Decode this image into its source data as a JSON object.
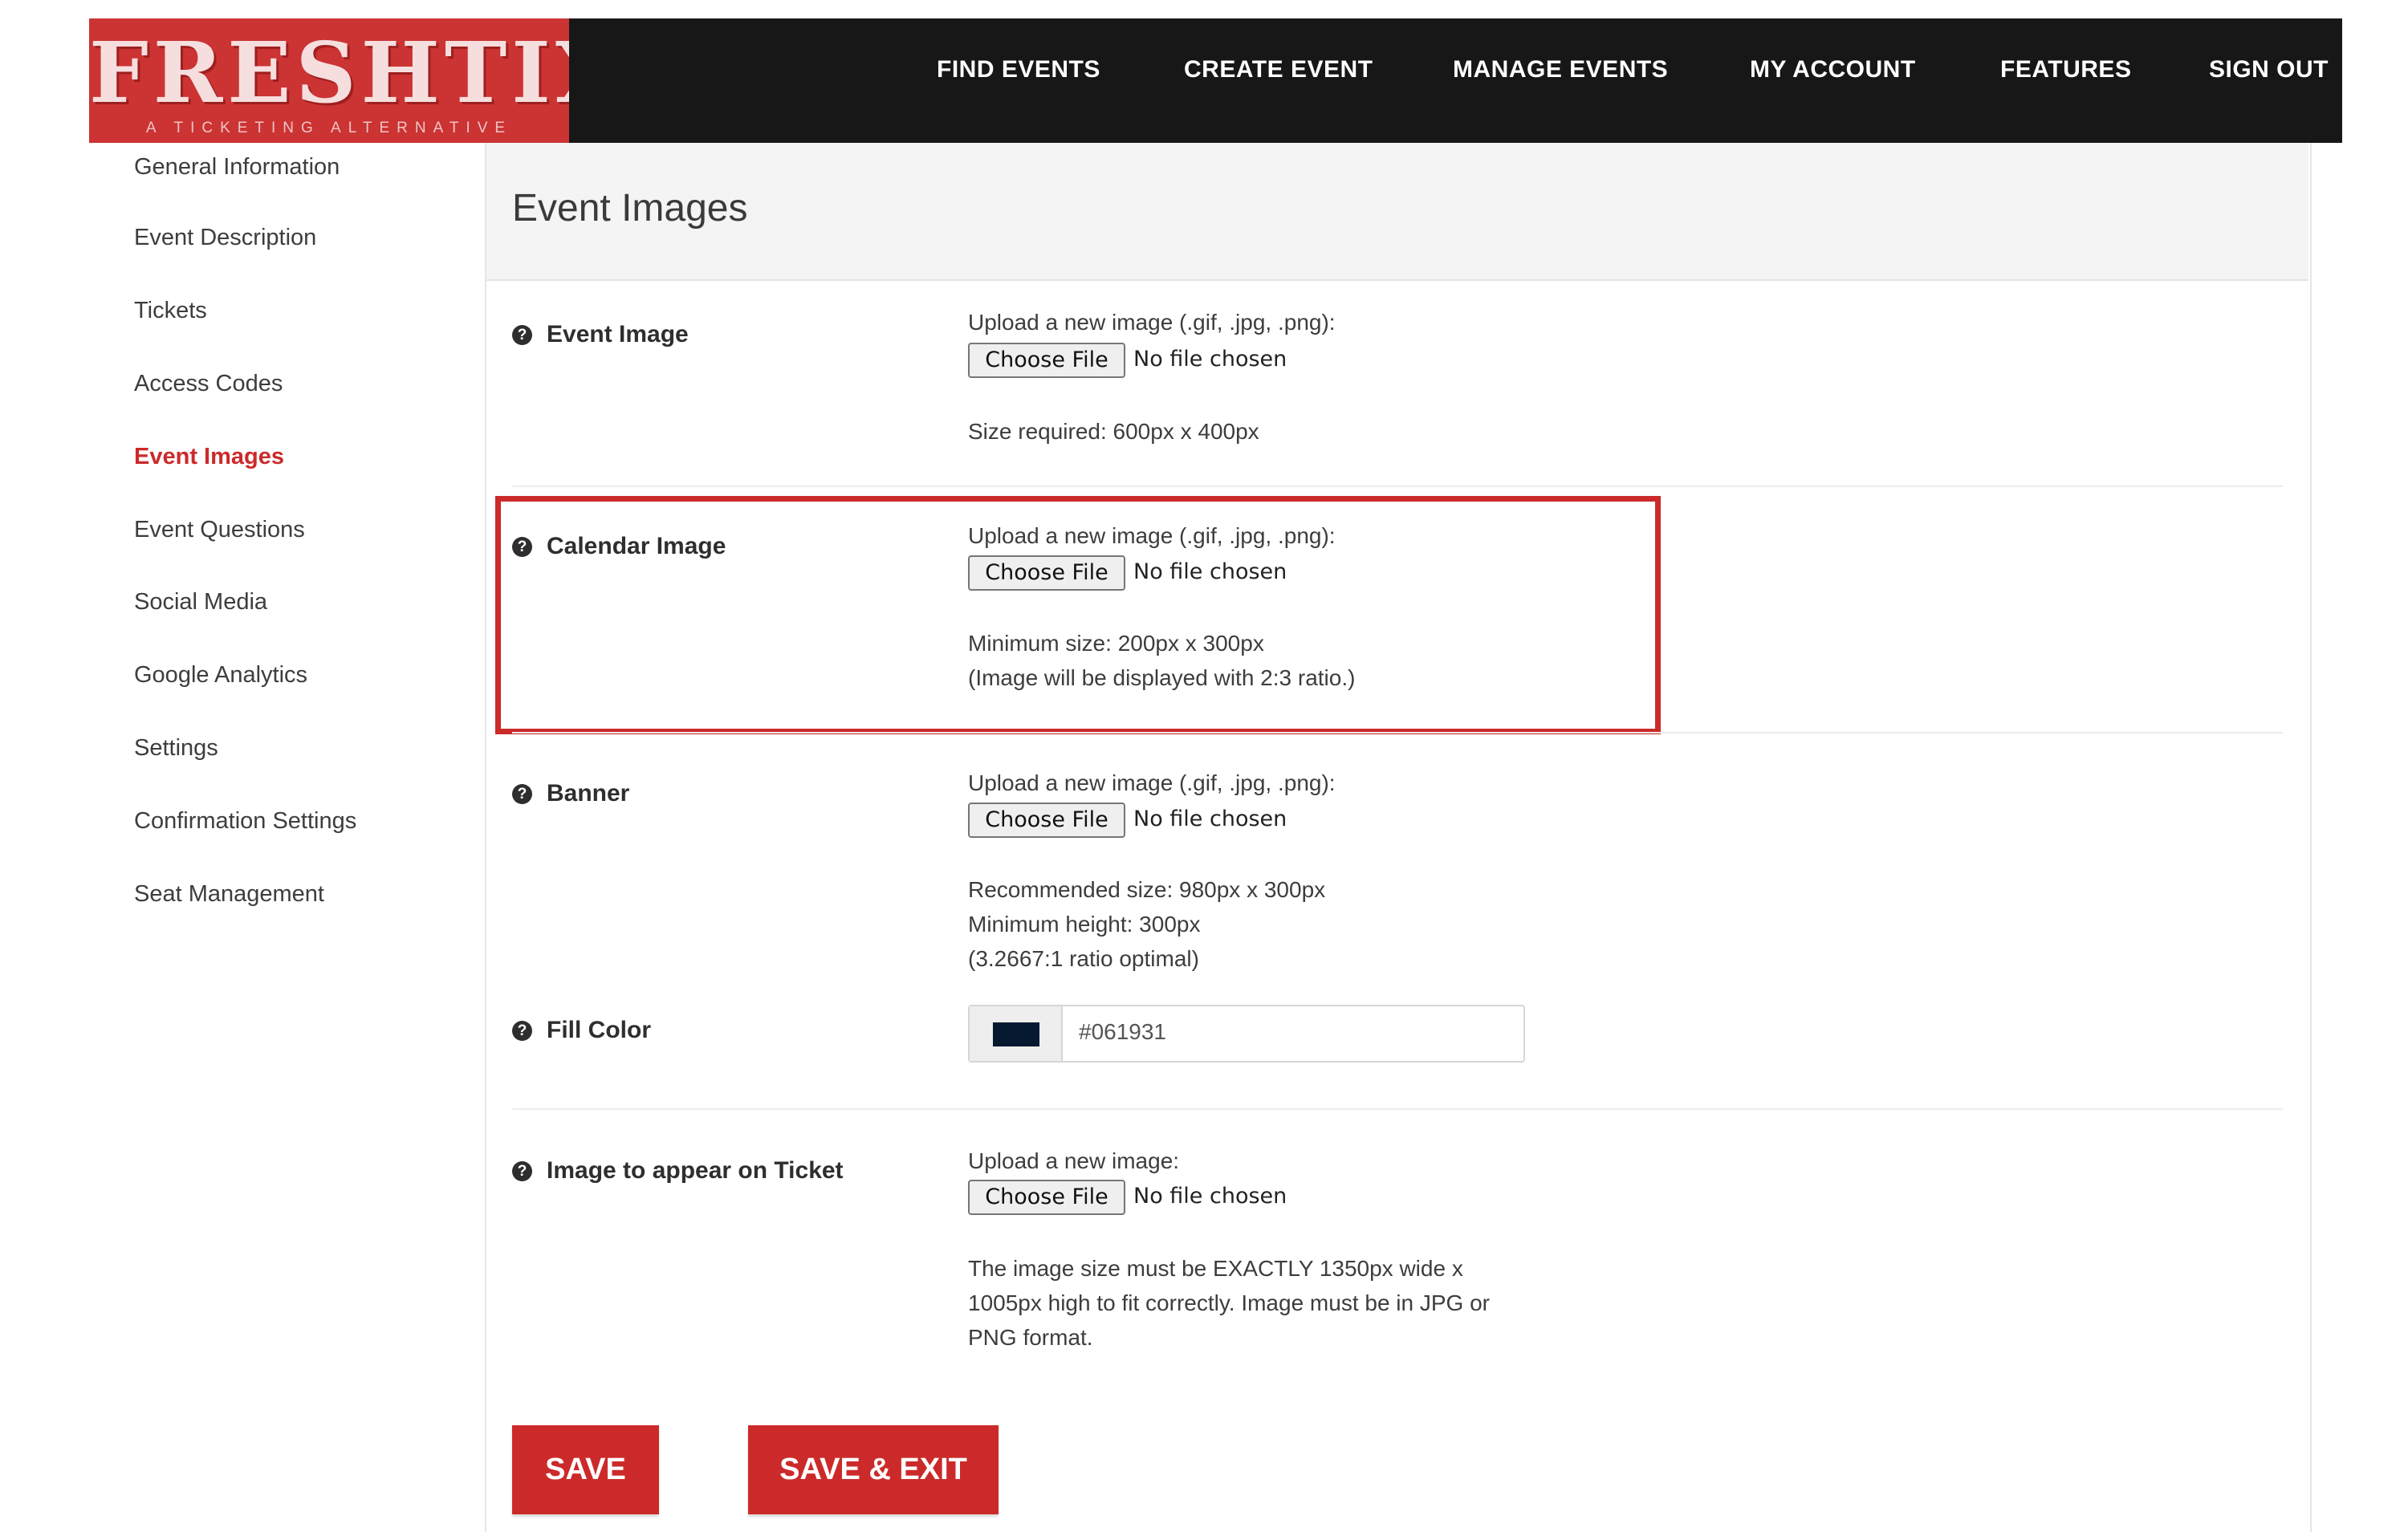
{
  "brand": {
    "name": "FRESHTIX",
    "tagline": "A TICKETING ALTERNATIVE",
    "color": "#cc3333"
  },
  "nav": {
    "find_events": "FIND EVENTS",
    "create_event": "CREATE EVENT",
    "manage_events": "MANAGE EVENTS",
    "my_account": "MY ACCOUNT",
    "features": "FEATURES",
    "sign_out": "SIGN OUT"
  },
  "sidebar": {
    "items": [
      {
        "label": "General Information"
      },
      {
        "label": "Event Description"
      },
      {
        "label": "Tickets"
      },
      {
        "label": "Access Codes"
      },
      {
        "label": "Event Images",
        "active": true
      },
      {
        "label": "Event Questions"
      },
      {
        "label": "Social Media"
      },
      {
        "label": "Google Analytics"
      },
      {
        "label": "Settings"
      },
      {
        "label": "Confirmation Settings"
      },
      {
        "label": "Seat Management"
      }
    ]
  },
  "main": {
    "title": "Event Images",
    "event_image": {
      "label": "Event Image",
      "upload_prompt": "Upload a new image (.gif, .jpg, .png):",
      "choose_file": "Choose File",
      "no_file": "No file chosen",
      "hint1": "Size required: 600px x 400px"
    },
    "calendar_image": {
      "label": "Calendar Image",
      "upload_prompt": "Upload a new image (.gif, .jpg, .png):",
      "choose_file": "Choose File",
      "no_file": "No file chosen",
      "hint1": "Minimum size: 200px x 300px",
      "hint2": "(Image will be displayed with 2:3 ratio.)"
    },
    "banner": {
      "label": "Banner",
      "upload_prompt": "Upload a new image (.gif, .jpg, .png):",
      "choose_file": "Choose File",
      "no_file": "No file chosen",
      "hint1": "Recommended size: 980px x 300px",
      "hint2": "Minimum height: 300px",
      "hint3": "(3.2667:1 ratio optimal)"
    },
    "fill_color": {
      "label": "Fill Color",
      "value": "#061931"
    },
    "ticket_image": {
      "label": "Image to appear on Ticket",
      "upload_prompt": "Upload a new image:",
      "choose_file": "Choose File",
      "no_file": "No file chosen",
      "hint1": "The image size must be EXACTLY 1350px wide x",
      "hint2": "1005px high to fit correctly. Image must be in JPG or",
      "hint3": "PNG format."
    },
    "save_label": "SAVE",
    "save_exit_label": "SAVE & EXIT"
  },
  "colors": {
    "accent": "#cc2a2a",
    "header_bg": "#171717"
  }
}
